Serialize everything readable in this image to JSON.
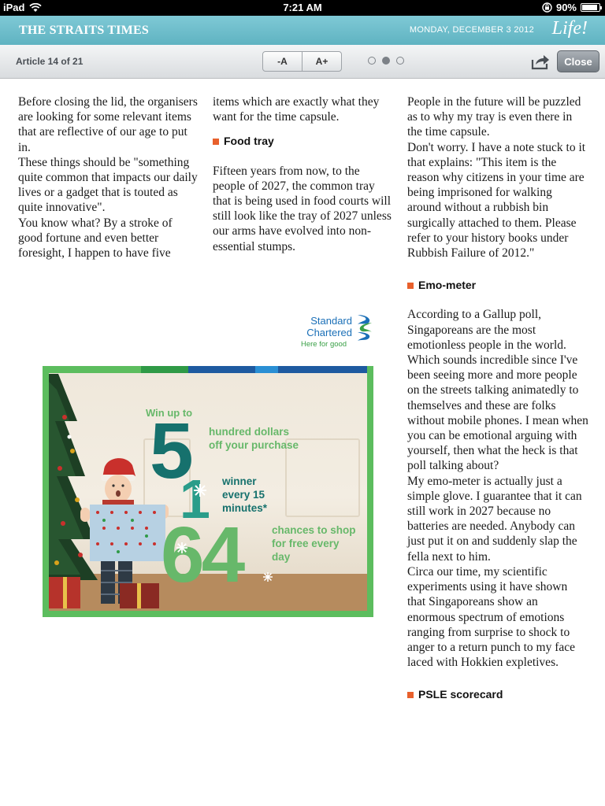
{
  "status_bar": {
    "device": "iPad",
    "time": "7:21 AM",
    "battery": "90%",
    "battery_level": 0.9
  },
  "masthead": {
    "paper": "THE STRAITS TIMES",
    "date": "MONDAY, DECEMBER 3 2012",
    "section": "Life!"
  },
  "toolbar": {
    "article_count": "Article 14 of 21",
    "font_smaller": "-A",
    "font_larger": "A+",
    "pages": 3,
    "active_page": 2,
    "share_icon": "share-icon",
    "close": "Close"
  },
  "article": {
    "col1": [
      " Before closing the lid, the organisers are looking for some relevant items that are reflective of our age to put in.",
      " These things should be \"something quite common that impacts our daily lives or a gadget that is touted as quite innovative\".",
      " You know what? By a stroke of good fortune and even better foresight, I happen to have five"
    ],
    "col2_intro": "items which are exactly what they want for the time capsule.",
    "food_tray_heading": "Food tray",
    "food_tray_text": "Fifteen years from now, to the people of 2027, the common tray that is being used in food courts will still look like the tray of 2027 unless our arms have evolved into non-essential stumps.",
    "col3_top": [
      " People in the future will be puzzled as to why my tray is even there in the time capsule.",
      " Don't worry. I have a note stuck to it that explains: \"This item is the reason why citizens in your time are being imprisoned for walking around without a rubbish bin surgically attached to them. Please refer to your history books under Rubbish Failure of 2012.\""
    ],
    "emo_heading": "Emo-meter",
    "emo_text": [
      "According to a Gallup poll, Singaporeans are the most emotionless people in the world. Which sounds incredible since I've been seeing more and more people on the streets talking animatedly to themselves and these are folks without mobile phones. I mean when you can be emotional arguing with yourself, then what the heck is that poll talking about?",
      " My emo-meter is actually just a simple glove. I guarantee that it can still work in 2027 because no batteries are needed. Anybody can just put it on and suddenly slap the fella next to him.",
      " Circa our time, my scientific experiments using it have shown that Singaporeans show an enormous spectrum of emotions ranging from surprise to shock to anger to a return punch to my face laced with Hokkien expletives."
    ],
    "psle_heading": "PSLE scorecard"
  },
  "ad": {
    "brand_line1": "Standard",
    "brand_line2": "Chartered",
    "tagline": "Here for good",
    "win_up_to": "Win up to",
    "num1": "5",
    "text1": "hundred dollars off your purchase",
    "num2": "1",
    "text2": "winner every 15 minutes*",
    "num3": "64",
    "text3": "chances to shop for free every day",
    "colors": {
      "green": "#5cbd5e",
      "teal": "#16716d",
      "light_green": "#67b86a",
      "blue": "#1a6fb7"
    }
  }
}
